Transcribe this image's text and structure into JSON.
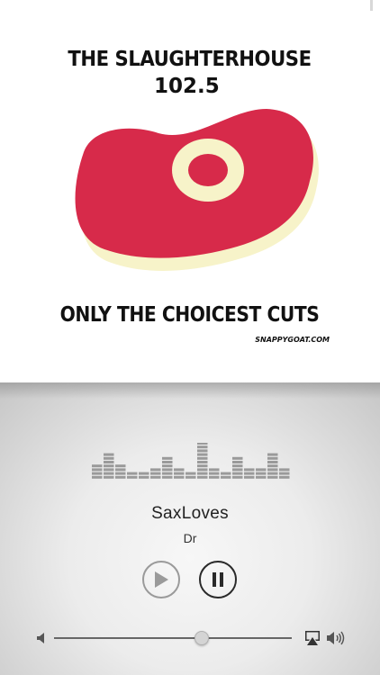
{
  "artwork": {
    "title": "THE SLAUGHTERHOUSE",
    "frequency": "102.5",
    "tagline": "ONLY THE CHOICEST CUTS",
    "watermark": "SNAPPYGOAT.COM"
  },
  "now_playing": {
    "title": "SaxLoves",
    "artist": "Dr"
  },
  "volume": {
    "level": 0.62
  },
  "colors": {
    "steak_red": "#d72a4a",
    "steak_fat": "#f7f3c9",
    "player_text": "#222222"
  },
  "icons": {
    "play": "play-icon",
    "pause": "pause-icon",
    "volume_min": "speaker-min-icon",
    "volume_max": "speaker-max-icon",
    "airplay": "airplay-icon"
  }
}
